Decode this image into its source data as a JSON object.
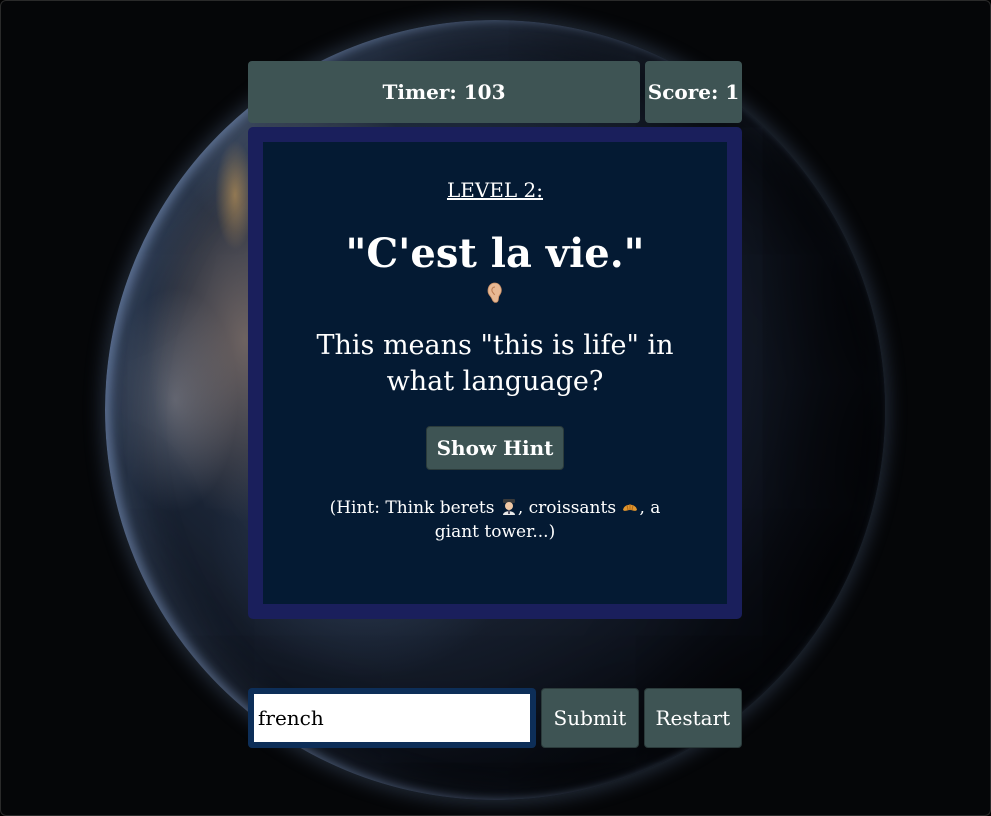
{
  "topbar": {
    "timer": "Timer: 103",
    "score": "Score: 1"
  },
  "card": {
    "level": "LEVEL 2:",
    "phrase": "\"C'est la vie.\"",
    "ear_icon": "ear-icon",
    "question": "This means \"this is life\" in what language?",
    "hint_button": "Show Hint",
    "hint": {
      "part1": "(Hint: Think berets ",
      "emoji1": "artist-emoji",
      "part2": ", croissants ",
      "emoji2": "croissant-emoji",
      "part3": ", a giant tower...)"
    }
  },
  "answer": {
    "value": "french",
    "submit_label": "Submit",
    "restart_label": "Restart"
  },
  "colors": {
    "panel": "#3e5454",
    "card_border": "#1a1f5c",
    "card_bg": "#041a33",
    "input_border": "#0d2e58"
  }
}
